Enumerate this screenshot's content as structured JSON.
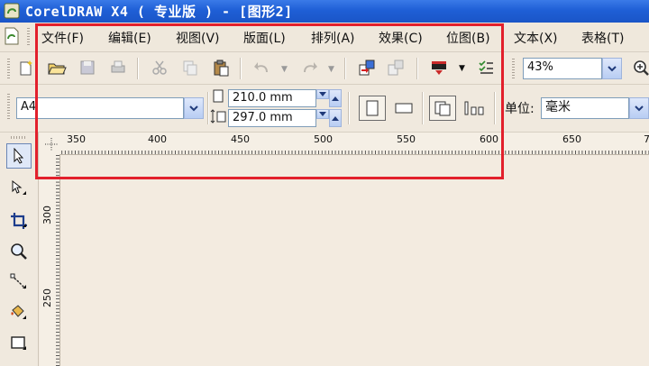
{
  "window": {
    "title": "CorelDRAW X4 ( 专业版 ) - [图形2]"
  },
  "menu": [
    "文件(F)",
    "编辑(E)",
    "视图(V)",
    "版面(L)",
    "排列(A)",
    "效果(C)",
    "位图(B)",
    "文本(X)",
    "表格(T)"
  ],
  "toolbar": {
    "zoom": "43%"
  },
  "property_bar": {
    "paper_size": "A4",
    "width": "210.0 mm",
    "height": "297.0 mm",
    "units_label": "单位:",
    "units_value": "毫米"
  },
  "ruler": {
    "h_ticks": [
      "350",
      "400",
      "450",
      "500",
      "550",
      "600",
      "650",
      "7"
    ],
    "v_ticks": [
      "300",
      "250"
    ]
  },
  "colors": {
    "title_bar": "#1f5fd6",
    "highlight": "#e2202c",
    "canvas": "#f3ebe0"
  }
}
